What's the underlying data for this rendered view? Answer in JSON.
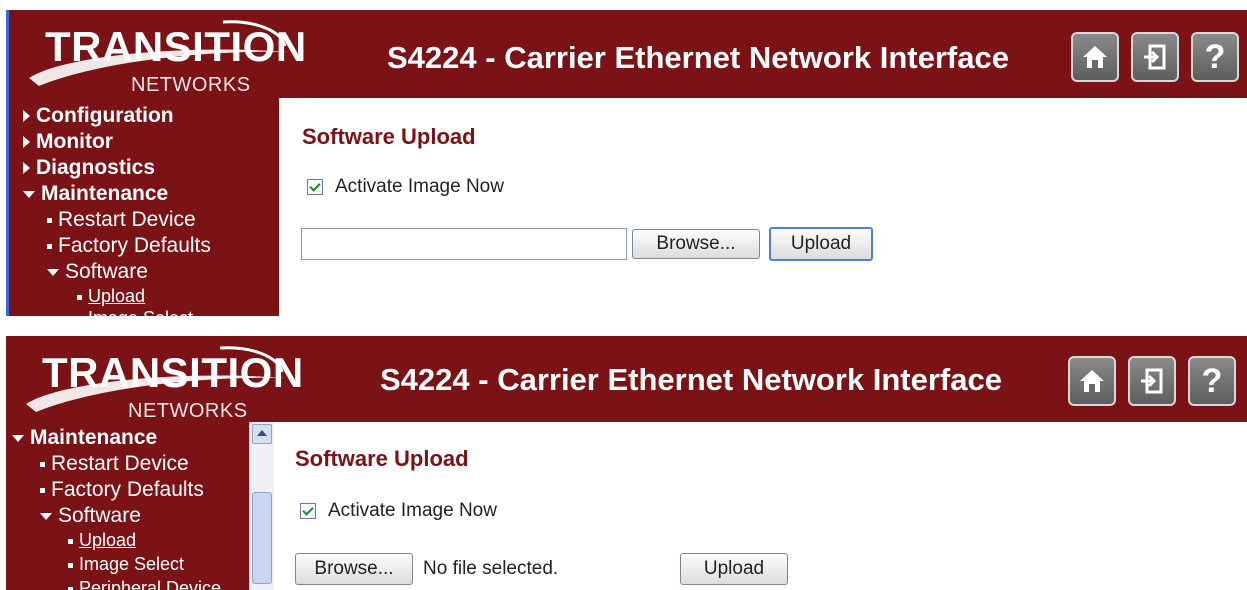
{
  "colors": {
    "brand": "#7a1216",
    "heading": "#7a1216",
    "accent_border": "#3a6fd8"
  },
  "top_panel": {
    "logo": {
      "word": "TRANSITION",
      "sub": "NETWORKS"
    },
    "title": "S4224 - Carrier Ethernet Network Interface",
    "icons": [
      "home-icon",
      "logout-icon",
      "help-icon"
    ],
    "help_glyph": "?",
    "nav": {
      "configuration": "Configuration",
      "monitor": "Monitor",
      "diagnostics": "Diagnostics",
      "maintenance": "Maintenance",
      "restart": "Restart Device",
      "factory": "Factory Defaults",
      "software": "Software",
      "upload": "Upload",
      "image_select": "Image Select"
    },
    "heading": "Software Upload",
    "checkbox_label": "Activate Image Now",
    "checkbox_checked": true,
    "file_value": "",
    "browse_label": "Browse...",
    "upload_label": "Upload"
  },
  "bottom_panel": {
    "logo": {
      "word": "TRANSITION",
      "sub": "NETWORKS"
    },
    "title": "S4224 - Carrier Ethernet Network Interface",
    "icons": [
      "home-icon",
      "logout-icon",
      "help-icon"
    ],
    "help_glyph": "?",
    "nav": {
      "maintenance": "Maintenance",
      "restart": "Restart Device",
      "factory": "Factory Defaults",
      "software": "Software",
      "upload": "Upload",
      "image_select": "Image Select",
      "peripheral": "Peripheral Device"
    },
    "heading": "Software Upload",
    "checkbox_label": "Activate Image Now",
    "checkbox_checked": true,
    "browse_label": "Browse...",
    "no_file_text": "No file selected.",
    "upload_label": "Upload"
  }
}
